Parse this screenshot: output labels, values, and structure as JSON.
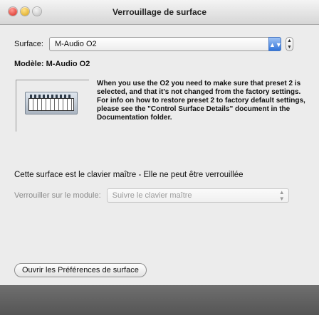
{
  "window": {
    "title": "Verrouillage de surface"
  },
  "surface": {
    "label": "Surface:",
    "selected": "M-Audio O2"
  },
  "model": {
    "text": "Modèle: M-Audio O2"
  },
  "device_description": "When you use the O2 you need to make sure that preset 2 is selected, and that it's not changed from the factory settings.\nFor info on how to restore preset 2 to factory default settings, please see the \"Control Surface Details\" document in the Documentation folder.",
  "master_notice": "Cette surface est le clavier maître - Elle ne peut être verrouillée",
  "lock": {
    "label": "Verrouiller sur le module:",
    "selected": "Suivre le clavier maître"
  },
  "preferences_button": "Ouvrir les Préférences de surface",
  "icons": {
    "close": "close-icon",
    "minimize": "minimize-icon",
    "zoom": "zoom-icon"
  }
}
